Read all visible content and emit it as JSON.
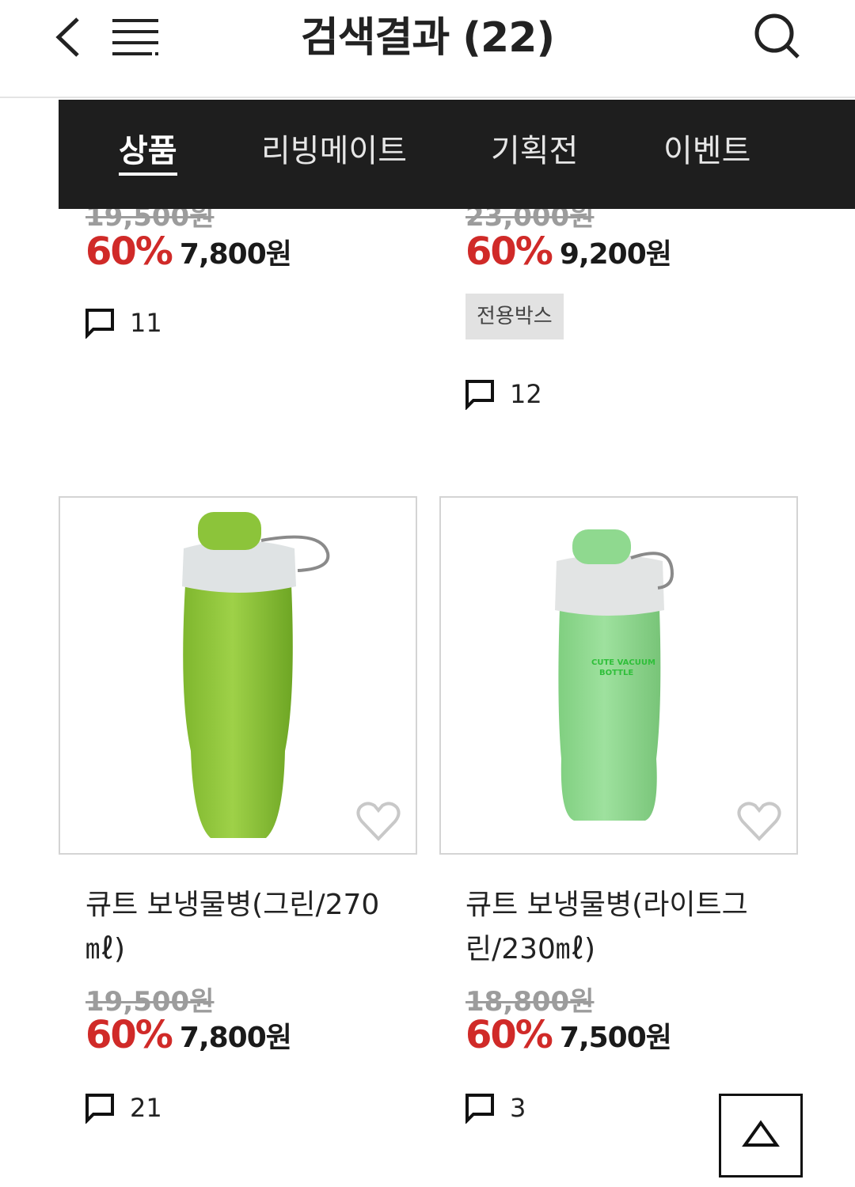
{
  "header": {
    "title": "검색결과 (22)",
    "back_icon": "chevron-left-icon",
    "menu_icon": "hamburger-menu-icon",
    "search_icon": "search-icon"
  },
  "tabs": [
    {
      "label": "상품",
      "active": true
    },
    {
      "label": "리빙메이트",
      "active": false
    },
    {
      "label": "기획전",
      "active": false
    },
    {
      "label": "이벤트",
      "active": false
    }
  ],
  "products": [
    {
      "original_price": "19,500원",
      "discount": "60%",
      "sale_price": "7,800원",
      "review_count": "11"
    },
    {
      "original_price": "23,000원",
      "discount": "60%",
      "sale_price": "9,200원",
      "badge": "전용박스",
      "review_count": "12"
    },
    {
      "name": "큐트 보냉물병(그린/270㎖)",
      "image": "green-water-bottle",
      "original_price": "19,500원",
      "discount": "60%",
      "sale_price": "7,800원",
      "review_count": "21"
    },
    {
      "name": "큐트 보냉물병(라이트그린/230㎖)",
      "image": "light-green-water-bottle",
      "bottle_print": [
        "CUTE VACUUM",
        "BOTTLE"
      ],
      "original_price": "18,800원",
      "discount": "60%",
      "sale_price": "7,500원",
      "review_count": "3"
    }
  ],
  "colors": {
    "discount": "#d02a28",
    "tabbar_bg": "#1e1e1e",
    "badge_bg": "#e2e2e2",
    "bottle_green": "#8cc43a",
    "bottle_light_green": "#8fd98f"
  },
  "scroll_top_icon": "triangle-up-icon"
}
